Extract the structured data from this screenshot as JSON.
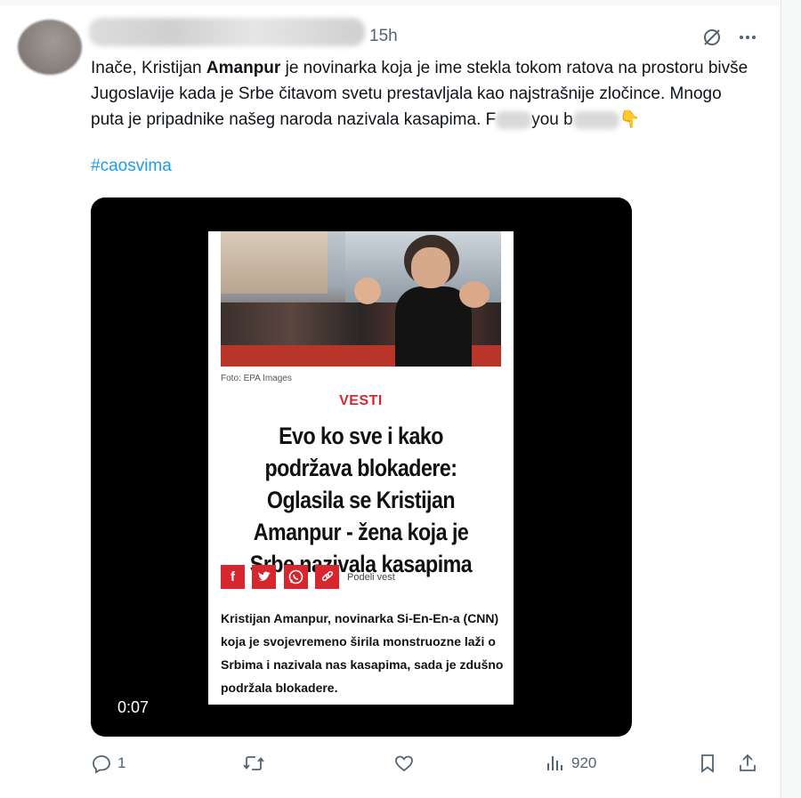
{
  "tweet": {
    "time": "15h",
    "text_parts": {
      "p1": "Inače, Kristijan ",
      "bold": "Amanpur",
      "p2": " je novinarka koja je ime stekla tokom ratova na prostoru bivše Jugoslavije kada je Srbe čitavom svetu prestavljala kao najstrašnije zločince. Mnogo puta je pripadnike našeg naroda nazivala kasapima. F",
      "p3": "you b",
      "emoji": "👇"
    },
    "hashtag": "#caosvima"
  },
  "media": {
    "duration": "0:07",
    "article": {
      "photo_caption": "Foto: EPA Images",
      "category": "VESTI",
      "headline": "Evo ko sve i kako podržava blokadere: Oglasila se Kristijan Amanpur - žena koja je Srbe nazivala kasapima",
      "share_label": "Podeli vest",
      "share_buttons": [
        "f",
        "twitter-bird",
        "whatsapp",
        "link"
      ],
      "lead": "Kristijan Amanpur, novinarka Si-En-En-a (CNN) koja je svojevremeno širila monstruozne laži o Srbima i nazivala nas kasapima, sada je zdušno podržala blokadere."
    }
  },
  "actions": {
    "replies": "1",
    "retweets": "",
    "likes": "",
    "views": "920"
  },
  "colors": {
    "accent": "#1d9bf0",
    "muted": "#536471",
    "article_red": "#d8262e"
  }
}
